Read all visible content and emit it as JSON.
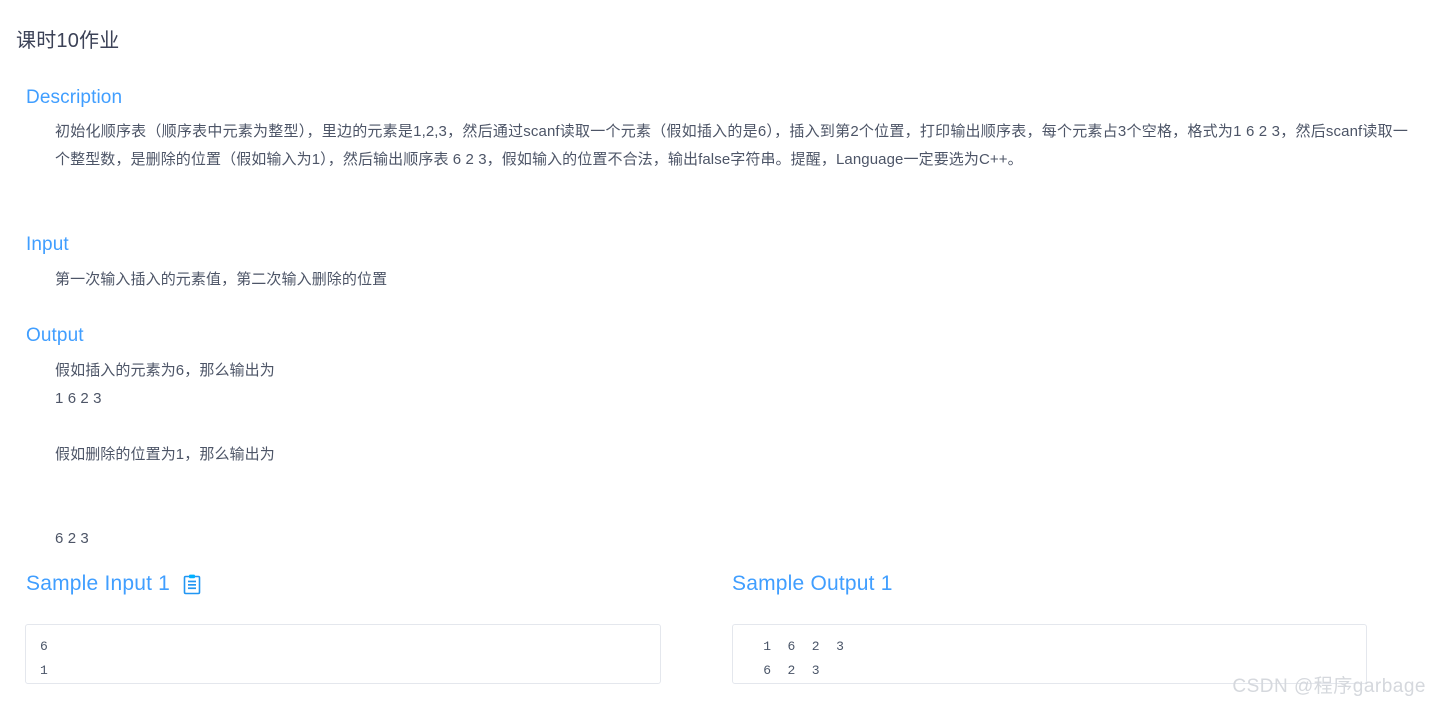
{
  "page": {
    "title": "课时10作业"
  },
  "sections": {
    "description": {
      "heading": "Description",
      "body": "初始化顺序表（顺序表中元素为整型），里边的元素是1,2,3，然后通过scanf读取一个元素（假如插入的是6），插入到第2个位置，打印输出顺序表，每个元素占3个空格，格式为1  6  2  3，然后scanf读取一个整型数，是删除的位置（假如输入为1），然后输出顺序表  6  2  3，假如输入的位置不合法，输出false字符串。提醒，Language一定要选为C++。"
    },
    "input": {
      "heading": "Input",
      "body": "第一次输入插入的元素值，第二次输入删除的位置"
    },
    "output": {
      "heading": "Output",
      "body": "假如插入的元素为6，那么输出为\n1 6 2 3\n\n假如删除的位置为1，那么输出为\n\n\n6 2 3"
    }
  },
  "samples": {
    "input": {
      "header": "Sample Input 1",
      "copy_icon": "clipboard-copy-icon",
      "content": "6\n1"
    },
    "output": {
      "header": "Sample Output 1",
      "content": "  1  6  2  3\n  6  2  3"
    }
  },
  "watermark": {
    "text": "CSDN @程序garbage"
  },
  "colors": {
    "heading_blue": "#409EFF",
    "body_text": "#4d5567",
    "title_text": "#3c4257",
    "box_border": "#e4e7ed",
    "watermark": "#d5d8dd"
  }
}
